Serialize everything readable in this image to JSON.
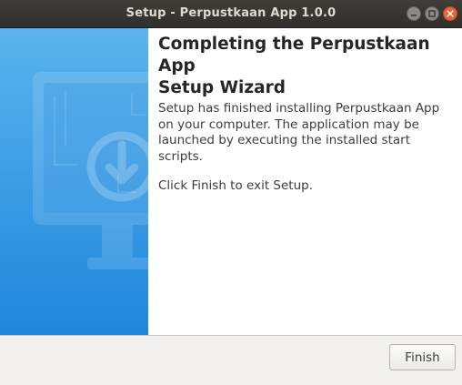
{
  "window": {
    "title": "Setup - Perpustkaan App 1.0.0",
    "controls": {
      "minimize_icon": "minimize-icon",
      "maximize_icon": "maximize-icon",
      "close_icon": "close-icon"
    }
  },
  "banner": {
    "icon": "monitor-download-icon",
    "colors": {
      "top": "#5ab4ec",
      "bottom": "#1f86dd"
    }
  },
  "content": {
    "heading": "Completing the Perpustkaan App\nSetup Wizard",
    "message": "Setup has finished installing Perpustkaan App\non your computer. The application may be\nlaunched by executing the installed start\nscripts.",
    "exit_note": "Click Finish to exit Setup."
  },
  "footer": {
    "finish_label": "Finish"
  }
}
